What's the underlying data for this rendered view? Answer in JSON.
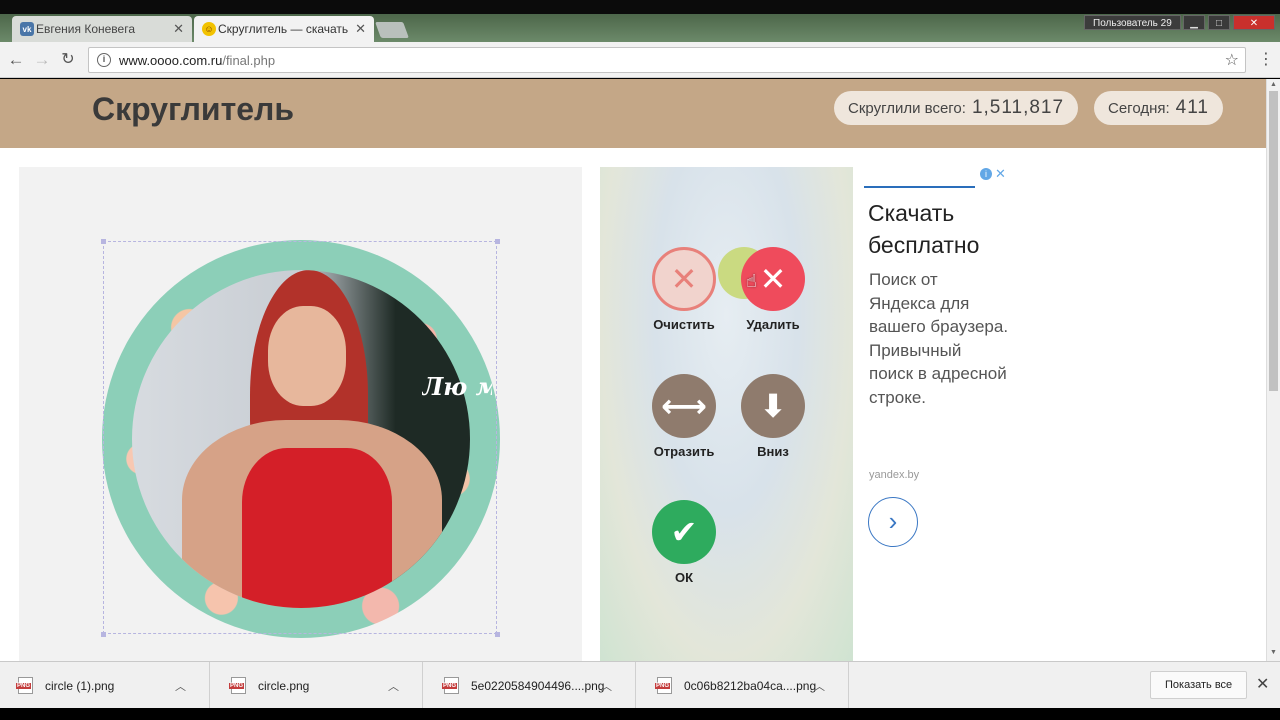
{
  "browser": {
    "tabs": [
      {
        "label": "Евгения Коневега",
        "icon": "vk-icon"
      },
      {
        "label": "Скруглитель — скачать",
        "icon": "smile-icon"
      }
    ],
    "user_badge": "Пользователь 29",
    "url_host": "www.oooo.com.ru",
    "url_path": "/final.php"
  },
  "site": {
    "title": "Скруглитель",
    "stats": {
      "total_label": "Скруглили всего:",
      "total_value": "1,511,817",
      "today_label": "Сегодня:",
      "today_value": "411"
    },
    "ring_text": "Лю мн Др До"
  },
  "tools": {
    "clear": "Очистить",
    "delete": "Удалить",
    "mirror": "Отразить",
    "down": "Вниз",
    "ok": "ОК"
  },
  "ad": {
    "headline": "Скачать бесплатно",
    "body": "Поиск от Яндекса для вашего браузера. Привычный поиск в адресной строке.",
    "source": "yandex.by"
  },
  "downloads": {
    "items": [
      {
        "name": "circle (1).png"
      },
      {
        "name": "circle.png"
      },
      {
        "name": "5e0220584904496....png"
      },
      {
        "name": "0c06b8212ba04ca....png"
      }
    ],
    "show_all": "Показать все"
  },
  "colors": {
    "header_bg": "#c4a787",
    "delete": "#ef4b5c",
    "ok": "#2eab5e",
    "brown_tool": "#8f7b6d"
  }
}
